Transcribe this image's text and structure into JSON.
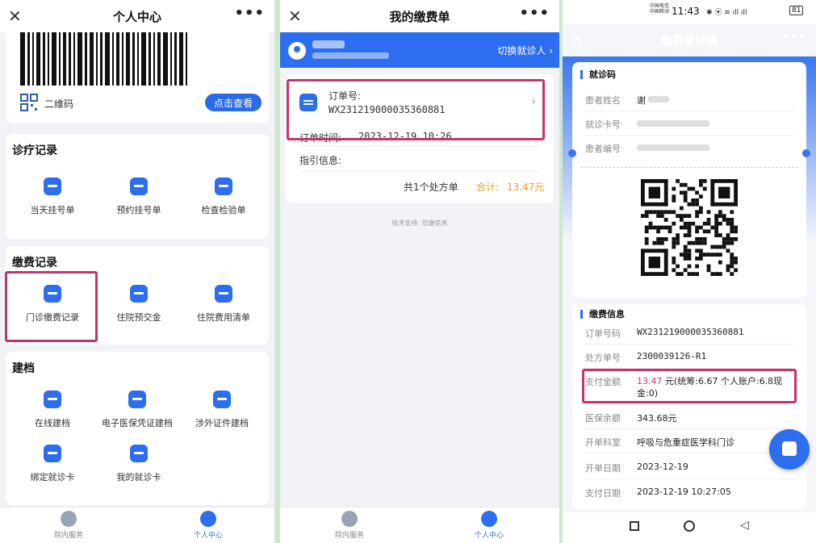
{
  "panel1": {
    "title": "个人中心",
    "qr_label": "二维码",
    "view_button": "点击查看",
    "diagnosis": {
      "title": "诊疗记录",
      "items": [
        {
          "label": "当天挂号单",
          "icon": "ticket-icon"
        },
        {
          "label": "预约挂号单",
          "icon": "clock-icon"
        },
        {
          "label": "检查检验单",
          "icon": "checklist-icon"
        }
      ]
    },
    "payment": {
      "title": "缴费记录",
      "items": [
        {
          "label": "门诊缴费记录",
          "icon": "card-yuan-icon"
        },
        {
          "label": "住院预交金",
          "icon": "id-card-icon"
        },
        {
          "label": "住院费用清单",
          "icon": "money-bag-icon"
        }
      ]
    },
    "archive": {
      "title": "建档",
      "items": [
        {
          "label": "在线建档",
          "icon": "add-card-icon"
        },
        {
          "label": "电子医保凭证建档",
          "icon": "card-check-icon"
        },
        {
          "label": "涉外证件建档",
          "icon": "card-check-icon"
        },
        {
          "label": "绑定就诊卡",
          "icon": "link-card-icon"
        },
        {
          "label": "我的就诊卡",
          "icon": "card-icon"
        }
      ]
    },
    "nav": [
      {
        "label": "院内服务",
        "color": "#9aa3b5"
      },
      {
        "label": "个人中心",
        "color": "#2d6ef0"
      }
    ]
  },
  "panel2": {
    "title": "我的缴费单",
    "switch_label": "切换就诊人",
    "order_label": "订单号:",
    "order_no": "WX231219000035360881",
    "order_time_label": "订单时间:",
    "order_time": "2023-12-19 10:26",
    "guide_label": "指引信息:",
    "summary": "共1个处方单",
    "total_label": "合计:",
    "total": "13.47元",
    "footer": "技术支持: 倍康信息",
    "nav": [
      {
        "label": "院内服务",
        "color": "#9aa3b5"
      },
      {
        "label": "个人中心",
        "color": "#2d6ef0"
      }
    ]
  },
  "panel3": {
    "status": {
      "carrier1": "中国电信",
      "carrier2": "中国移动",
      "time": "11:43",
      "battery": "81"
    },
    "title": "缴费单详情",
    "visit_section": "就诊码",
    "visit": {
      "name_label": "患者姓名",
      "name_value": "谢",
      "card_label": "就诊卡号",
      "id_label": "患者编号"
    },
    "pay_section": "缴费信息",
    "pay": [
      {
        "k": "订单号码",
        "v": "WX231219000035360881"
      },
      {
        "k": "处方单号",
        "v": "2300039126-R1"
      },
      {
        "k": "医保余额",
        "v": "343.68元"
      },
      {
        "k": "开单科室",
        "v": "呼吸与危重症医学科门诊"
      },
      {
        "k": "开单日期",
        "v": "2023-12-19"
      },
      {
        "k": "支付日期",
        "v": "2023-12-19 10:27:05"
      }
    ],
    "amount_label": "支付金额",
    "amount_value": "13.47",
    "amount_detail1": "元(统筹:6.67 个人账户:6.8现",
    "amount_detail2": "金:0)",
    "accent_red": "#e0306e"
  }
}
